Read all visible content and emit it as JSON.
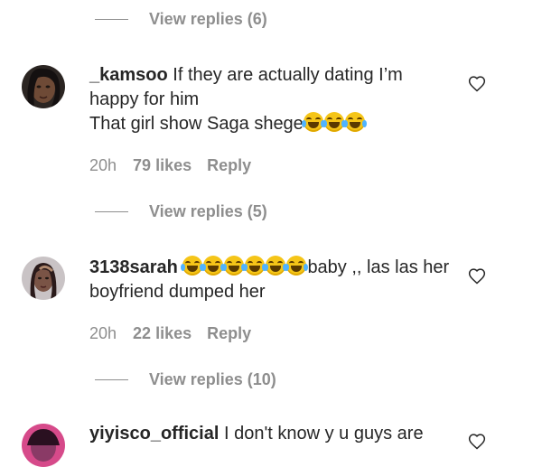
{
  "replies_top": {
    "label": "View replies (6)"
  },
  "comments": [
    {
      "username": "_kamsoo",
      "text_line1": " If they are actually dating I’m happy for him",
      "text_line2": "That girl show Saga shege",
      "emoji_count": 3,
      "time": "20h",
      "likes": "79 likes",
      "reply": "Reply",
      "replies": "View replies (5)"
    },
    {
      "username": "3138sarah",
      "text_after_emoji": "baby ,, las las her boyfriend dumped her",
      "emoji_count": 6,
      "time": "20h",
      "likes": "22 likes",
      "reply": "Reply",
      "replies": "View replies (10)"
    },
    {
      "username": "yiyisco_official",
      "text": " I don't know y u guys are"
    }
  ],
  "icons": {
    "heart": "heart-outline-icon",
    "emoji": "face-with-tears-of-joy"
  },
  "colors": {
    "text": "#262626",
    "muted": "#8e8e8e",
    "background": "#ffffff"
  }
}
